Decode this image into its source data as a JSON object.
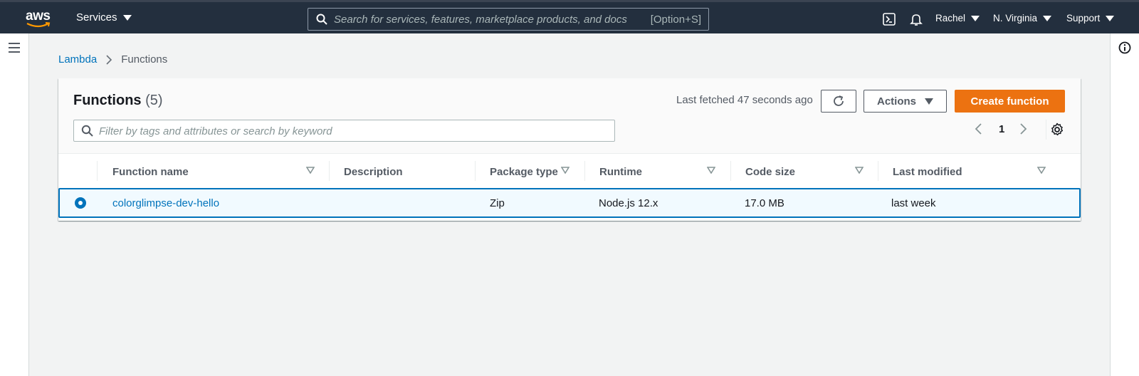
{
  "nav": {
    "logo_text": "aws",
    "services_label": "Services",
    "search_placeholder": "Search for services, features, marketplace products, and docs",
    "search_shortcut": "[Option+S]",
    "user_label": "Rachel",
    "region_label": "N. Virginia",
    "support_label": "Support"
  },
  "breadcrumb": {
    "root": "Lambda",
    "current": "Functions"
  },
  "panel": {
    "title": "Functions",
    "count": "(5)",
    "last_fetched": "Last fetched 47 seconds ago",
    "actions_label": "Actions",
    "create_label": "Create function",
    "filter_placeholder": "Filter by tags and attributes or search by keyword",
    "page_number": "1"
  },
  "table": {
    "columns": [
      "Function name",
      "Description",
      "Package type",
      "Runtime",
      "Code size",
      "Last modified"
    ],
    "rows": [
      {
        "selected": true,
        "function_name": "colorglimpse-dev-hello",
        "description": "",
        "package_type": "Zip",
        "runtime": "Node.js 12.x",
        "code_size": "17.0 MB",
        "last_modified": "last week"
      }
    ]
  },
  "colors": {
    "nav_bg": "#232f3e",
    "primary_button": "#ec7211",
    "link": "#0073bb",
    "selected_row_bg": "#f1faff"
  },
  "icons": [
    "aws-logo-icon",
    "search-icon",
    "caret-down-icon",
    "cloudshell-icon",
    "bell-icon",
    "menu-icon",
    "info-icon",
    "chevron-right-icon",
    "refresh-icon",
    "chevron-left-icon",
    "gear-icon",
    "sort-icon",
    "radio-selected-icon"
  ]
}
